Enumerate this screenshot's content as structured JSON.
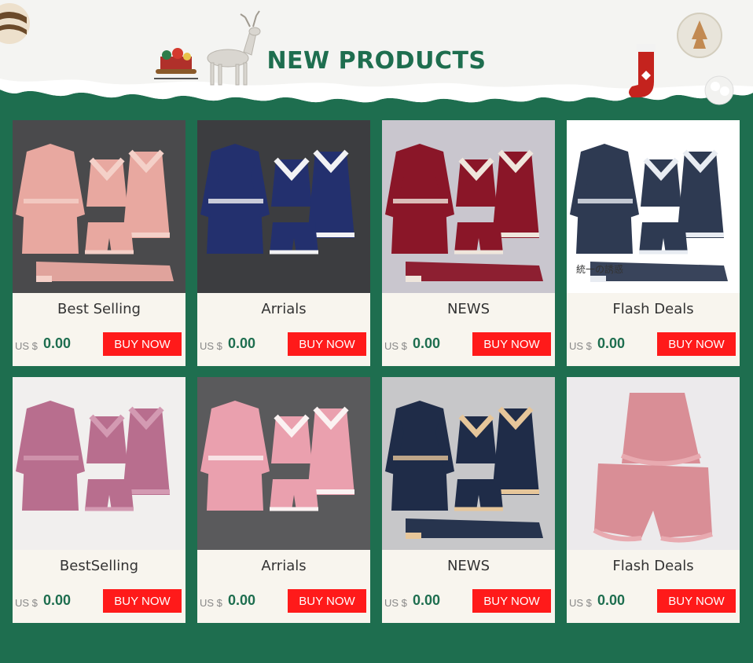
{
  "header": {
    "title": "NEW PRODUCTS"
  },
  "products": [
    {
      "name": "Best Selling",
      "currency": "US $",
      "price": "0.00",
      "button": "BUY NOW",
      "image": "pink-floral-pajama-set"
    },
    {
      "name": "Arrials",
      "currency": "US $",
      "price": "0.00",
      "button": "BUY NOW",
      "image": "navy-satin-lace-set"
    },
    {
      "name": "NEWS",
      "currency": "US $",
      "price": "0.00",
      "button": "BUY NOW",
      "image": "burgundy-velvet-set"
    },
    {
      "name": "Flash Deals",
      "currency": "US $",
      "price": "0.00",
      "button": "BUY NOW",
      "image": "navy-floral-set",
      "image_caption": "統一の誘惑"
    },
    {
      "name": "BestSelling",
      "currency": "US $",
      "price": "0.00",
      "button": "BUY NOW",
      "image": "mauve-velvet-set"
    },
    {
      "name": "Arrials",
      "currency": "US $",
      "price": "0.00",
      "button": "BUY NOW",
      "image": "pink-satin-lace-set"
    },
    {
      "name": "NEWS",
      "currency": "US $",
      "price": "0.00",
      "button": "BUY NOW",
      "image": "navy-gold-lace-set"
    },
    {
      "name": "Flash Deals",
      "currency": "US $",
      "price": "0.00",
      "button": "BUY NOW",
      "image": "pink-cami-shorts"
    }
  ],
  "colors": {
    "background": "#1e6e4f",
    "accent": "#1e6e4f",
    "button": "#ff1a1a",
    "card": "#f8f5ee"
  }
}
